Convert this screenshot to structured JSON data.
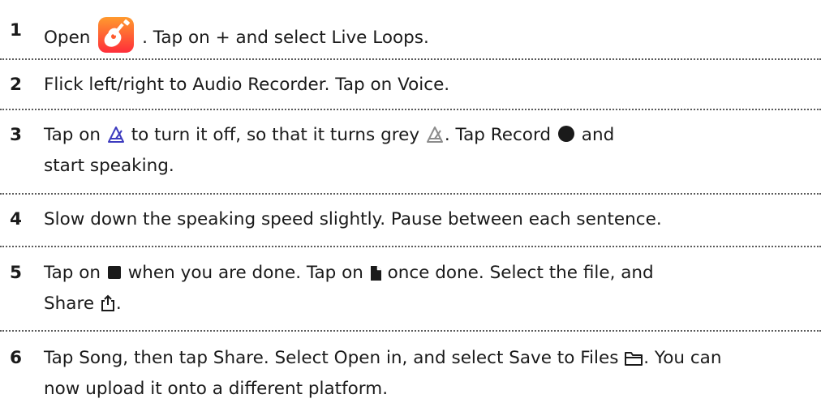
{
  "steps": [
    {
      "number": "1",
      "parts": {
        "a": "Open",
        "b": ". Tap on + and select Live Loops."
      },
      "icons": [
        "garageband-app-icon"
      ]
    },
    {
      "number": "2",
      "parts": {
        "a": "Flick left/right to Audio Recorder. Tap on Voice."
      }
    },
    {
      "number": "3",
      "parts": {
        "a": "Tap on",
        "b": "to turn it off, so that it turns grey",
        "c": ".  Tap Record",
        "d": "and",
        "e": "start speaking."
      },
      "icons": [
        "metronome-icon-on",
        "metronome-icon-grey",
        "record-icon"
      ]
    },
    {
      "number": "4",
      "parts": {
        "a": "Slow down the speaking speed slightly. Pause between each sentence."
      }
    },
    {
      "number": "5",
      "parts": {
        "a": "Tap on",
        "b": "when you are done. Tap on",
        "c": "once done. Select the file, and",
        "d": "Share",
        "e": "."
      },
      "icons": [
        "stop-icon",
        "document-icon",
        "share-icon"
      ]
    },
    {
      "number": "6",
      "parts": {
        "a": "Tap Song, then tap Share. Select Open in, and select Save to Files",
        "b": ". You can",
        "c": "now upload it onto a different platform."
      },
      "icons": [
        "folder-icon"
      ]
    }
  ],
  "colors": {
    "text": "#1a1a1a",
    "separator": "#5a5a5a",
    "metronome_active": "#3d3bbf",
    "metronome_grey": "#8c8c8c",
    "app_icon_top": "#ff9a2e",
    "app_icon_bottom": "#ff2d3a"
  }
}
